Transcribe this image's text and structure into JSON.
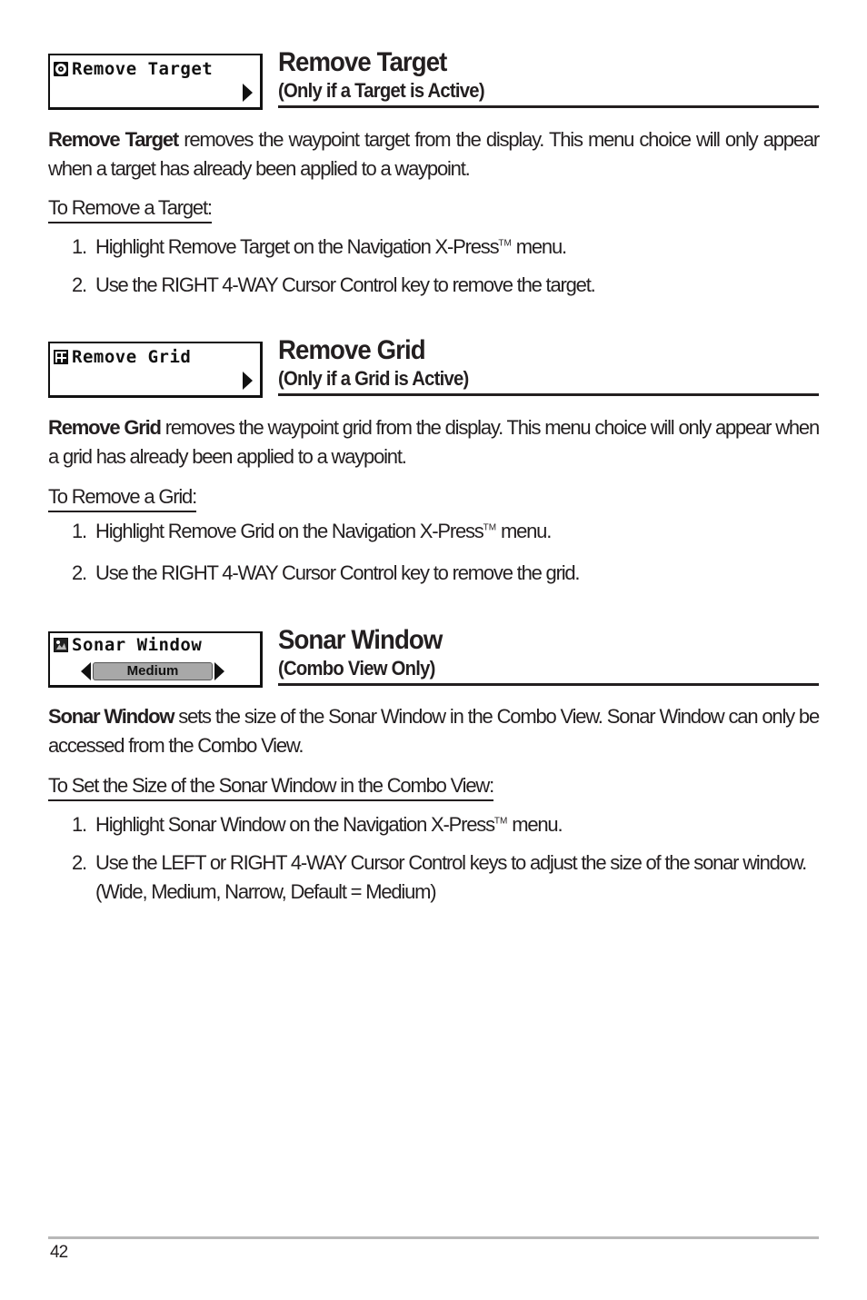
{
  "sections": [
    {
      "menu": {
        "icon": "target-icon",
        "label": "Remove Target",
        "control": "right-arrow"
      },
      "title": "Remove Target",
      "subtitle": "(Only if a Target is Active)",
      "intro_bold": "Remove Target",
      "intro_text": " removes the waypoint  target from the display. This menu choice will only appear when a target has already been applied to a waypoint.",
      "procedure_title": "To Remove a Target:",
      "steps": [
        {
          "num": "1.",
          "text_before": "Highlight Remove Target on the Navigation X-Press",
          "sup": "TM",
          "text_after": " menu."
        },
        {
          "num": "2.",
          "text": "Use the RIGHT 4-WAY Cursor Control key to remove the target."
        }
      ]
    },
    {
      "menu": {
        "icon": "grid-icon",
        "label": "Remove Grid",
        "control": "right-arrow"
      },
      "title": "Remove Grid",
      "subtitle": "(Only if a Grid is Active)",
      "intro_bold": "Remove Grid",
      "intro_text": " removes the waypoint grid from the display. This menu choice will only appear when a grid has already been applied to a waypoint.",
      "procedure_title": "To Remove a Grid:",
      "steps": [
        {
          "num": "1.",
          "text_before": "Highlight Remove Grid on the Navigation X-Press",
          "sup": "TM",
          "text_after": " menu."
        },
        {
          "num": "2.",
          "text": "Use the RIGHT 4-WAY Cursor Control key to remove the grid."
        }
      ]
    },
    {
      "menu": {
        "icon": "sonar-icon",
        "label": "Sonar Window",
        "control": "selector",
        "value": "Medium"
      },
      "title": "Sonar Window",
      "subtitle": "(Combo View Only)",
      "intro_bold": "Sonar Window",
      "intro_text": " sets the size of the Sonar Window in the Combo View. Sonar Window can only be accessed from the Combo View.",
      "procedure_title": "To Set the Size of the Sonar Window in the Combo View:",
      "steps": [
        {
          "num": "1.",
          "text_before": "Highlight Sonar Window on the Navigation X-Press",
          "sup": "TM",
          "text_after": " menu."
        },
        {
          "num": "2.",
          "text": "Use the LEFT or RIGHT 4-WAY Cursor Control keys to adjust the size of the sonar window. (Wide, Medium, Narrow, Default = Medium)"
        }
      ]
    }
  ],
  "footer": {
    "page_number": "42"
  }
}
